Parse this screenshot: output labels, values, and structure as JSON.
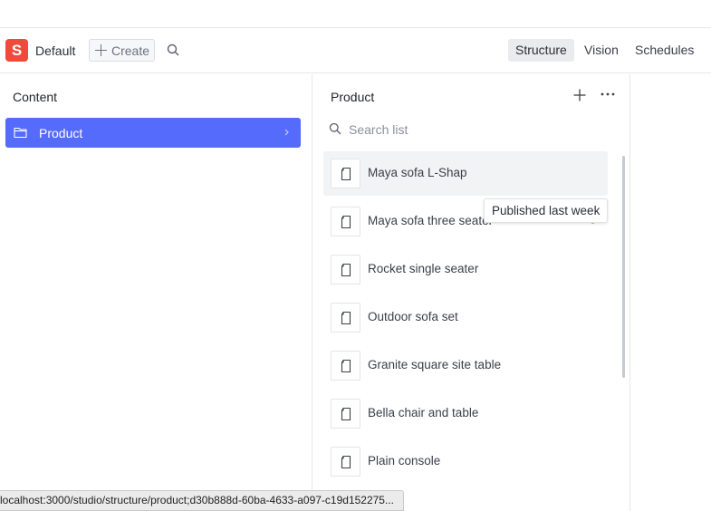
{
  "navbar": {
    "logo_letter": "S",
    "workspace_name": "Default",
    "create_label": "Create",
    "tools": [
      "Structure",
      "Vision",
      "Schedules"
    ],
    "active_tool": "Structure"
  },
  "content_pane": {
    "title": "Content",
    "items": [
      {
        "label": "Product",
        "icon": "folder-icon",
        "selected": true
      }
    ]
  },
  "product_pane": {
    "title": "Product",
    "search_placeholder": "Search list",
    "documents": [
      {
        "title": "Maya sofa L-Shap",
        "icon": "document-icon"
      },
      {
        "title": "Maya sofa three seater",
        "icon": "document-icon",
        "status": "Published last week"
      },
      {
        "title": "Rocket single seater",
        "icon": "document-icon"
      },
      {
        "title": "Outdoor sofa set",
        "icon": "document-icon"
      },
      {
        "title": "Granite square site table",
        "icon": "document-icon"
      },
      {
        "title": "Bella chair and table",
        "icon": "document-icon"
      },
      {
        "title": "Plain console",
        "icon": "document-icon"
      }
    ],
    "peek_text": "225"
  },
  "tooltip": {
    "text": "Published last week"
  },
  "status_bar": {
    "url": "localhost:3000/studio/structure/product;d30b888d-60ba-4633-a097-c19d152275..."
  },
  "colors": {
    "accent": "#556bfc",
    "logo": "#f04a3a",
    "status_dot": "#f0a23b"
  }
}
